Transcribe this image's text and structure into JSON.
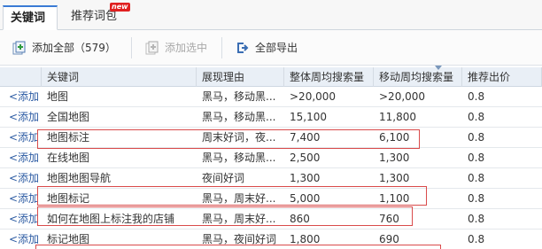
{
  "tabs": [
    {
      "label": "关键词",
      "active": true
    },
    {
      "label": "推荐词包",
      "badge": "new"
    }
  ],
  "toolbar": {
    "add_all": "添加全部（579）",
    "add_selected": "添加选中",
    "export_all": "全部导出"
  },
  "table": {
    "headers": [
      "关键词",
      "展现理由",
      "整体周均搜索量",
      "移动周均搜索量",
      "推荐出价"
    ],
    "action_label": "<添加",
    "rows": [
      {
        "keyword": "地图",
        "reason": "黑马，移动黑...",
        "overall": ">20,000",
        "mobile": ">20,000",
        "bid": "0.8"
      },
      {
        "keyword": "全国地图",
        "reason": "黑马，移动黑...",
        "overall": "15,100",
        "mobile": "11,800",
        "bid": "0.8"
      },
      {
        "keyword": "地图标注",
        "reason": "周末好词，夜...",
        "overall": "7,400",
        "mobile": "6,100",
        "bid": "0.8"
      },
      {
        "keyword": "在线地图",
        "reason": "黑马，移动黑...",
        "overall": "2,500",
        "mobile": "1,300",
        "bid": "0.8"
      },
      {
        "keyword": "地图地图导航",
        "reason": "夜间好词",
        "overall": "1,300",
        "mobile": "1,300",
        "bid": "0.8"
      },
      {
        "keyword": "地图标记",
        "reason": "黑马，周末好...",
        "overall": "5,000",
        "mobile": "1,100",
        "bid": "0.8"
      },
      {
        "keyword": "如何在地图上标注我的店铺",
        "reason": "黑马，周末好...",
        "overall": "860",
        "mobile": "760",
        "bid": "0.8"
      },
      {
        "keyword": "标记地图",
        "reason": "黑马，夜间好词",
        "overall": "1,800",
        "mobile": "690",
        "bid": "0.8"
      }
    ]
  },
  "colors": {
    "accent": "#2c5ba3",
    "header_bg": "#e9eff6",
    "annotation": "#d94b4b",
    "badge": "#e02020"
  }
}
